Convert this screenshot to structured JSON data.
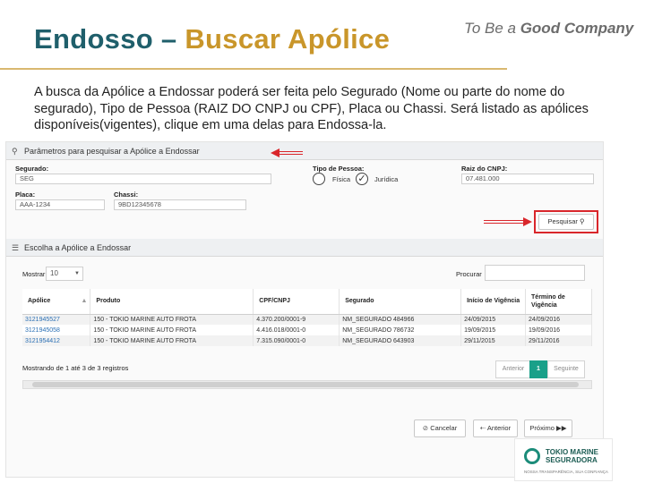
{
  "slide": {
    "title_part1": "Endosso – ",
    "title_part2": "Buscar Apólice",
    "tagline_regular": "To Be a ",
    "tagline_bold": "Good Company",
    "description": "A busca da Apólice a Endossar poderá ser feita pelo Segurado (Nome ou parte do nome do segurado), Tipo de Pessoa (RAIZ DO CNPJ ou CPF), Placa ou Chassi. Será listado as apólices disponíveis(vigentes), clique em uma delas para Endossa-la."
  },
  "search_panel": {
    "title": "Parâmetros para pesquisar a Apólice a Endossar",
    "segurado_label": "Segurado:",
    "segurado_value": "SEG",
    "tipo_pessoa_label": "Tipo de Pessoa:",
    "tipo_fisica": "Física",
    "tipo_juridica": "Jurídica",
    "raiz_cnpj_label": "Raiz do CNPJ:",
    "raiz_cnpj_value": "07.481.000",
    "placa_label": "Placa:",
    "placa_value": "AAA-1234",
    "chassi_label": "Chassi:",
    "chassi_value": "9BD12345678",
    "pesquisar_button": "Pesquisar"
  },
  "results_panel": {
    "title": "Escolha a Apólice a Endossar",
    "mostrar_label": "Mostrar",
    "page_size": "10",
    "procurar_label": "Procurar",
    "columns": [
      "Apólice",
      "Produto",
      "CPF/CNPJ",
      "Segurado",
      "Início de Vigência",
      "Término de Vigência"
    ],
    "rows": [
      [
        "3121945527",
        "150 - TOKIO MARINE AUTO FROTA",
        "4.370.200/0001-9",
        "NM_SEGURADO 484966",
        "24/09/2015",
        "24/09/2016"
      ],
      [
        "3121945058",
        "150 - TOKIO MARINE AUTO FROTA",
        "4.416.018/0001-0",
        "NM_SEGURADO 786732",
        "19/09/2015",
        "19/09/2016"
      ],
      [
        "3121954412",
        "150 - TOKIO MARINE AUTO FROTA",
        "7.315.090/0001-0",
        "NM_SEGURADO 643903",
        "29/11/2015",
        "29/11/2016"
      ]
    ],
    "footer_text": "Mostrando de 1 até 3 de 3 registros",
    "prev_button": "Anterior",
    "current_page": "1",
    "next_button": "Seguinte"
  },
  "wizard": {
    "cancel_button": "Cancelar",
    "prev_button": "Anterior",
    "next_button": "Próximo"
  },
  "logo": {
    "name_line1": "TOKIO MARINE",
    "name_line2": "SEGURADORA",
    "subtitle": "NOSSA TRANSPARÊNCIA, SUA CONFIANÇA"
  },
  "colors": {
    "title_teal": "#1f5f6b",
    "title_gold": "#c9962a",
    "highlight_red": "#d9262b",
    "active_page": "#1aa089",
    "link_blue": "#2a6fb4"
  },
  "icons": [
    "search-icon",
    "list-icon",
    "cancel-icon",
    "back-icon",
    "forward-icon",
    "sort-icon",
    "check-icon"
  ]
}
